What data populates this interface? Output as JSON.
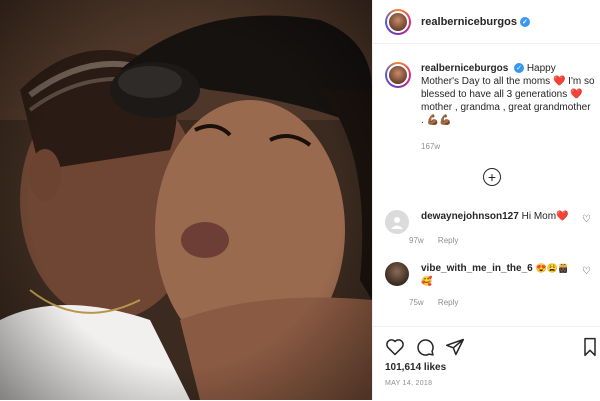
{
  "post": {
    "username": "realberniceburgos",
    "caption_username": "realberniceburgos",
    "caption": "Happy Mother's Day to all the moms ❤️ I'm so blessed to have all 3 generations ❤️ mother , grandma , great grandmother . 💪🏾💪🏾",
    "caption_time": "167w",
    "likes": "101,614 likes",
    "date": "MAY 14, 2018"
  },
  "comments": [
    {
      "username": "dewaynejohnson127",
      "text": "Hi Mom❤️",
      "time": "97w",
      "reply": "Reply"
    },
    {
      "username": "vibe_with_me_in_the_6",
      "text": "😍😩👸🏿🥰",
      "time": "75w",
      "reply": "Reply"
    }
  ],
  "icons": {
    "verified": "verified-badge",
    "load_more": "plus-circle",
    "like": "heart-outline",
    "comment": "speech-bubble",
    "share": "paper-plane",
    "save": "bookmark"
  },
  "colors": {
    "verified_blue": "#3897f0",
    "heart_red": "#ed4956"
  }
}
